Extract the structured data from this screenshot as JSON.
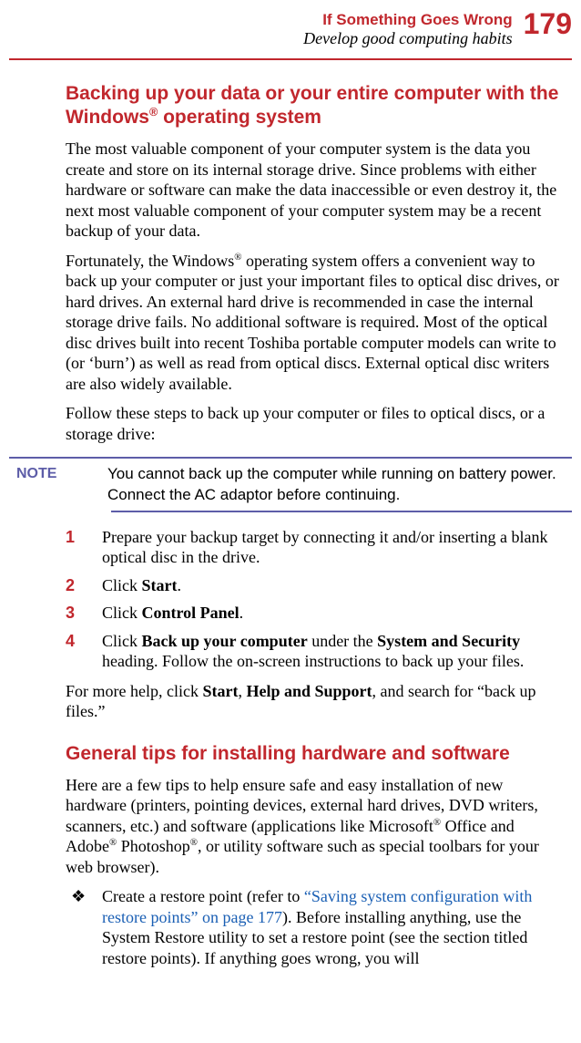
{
  "header": {
    "chapter": "If Something Goes Wrong",
    "section": "Develop good computing habits",
    "page": "179"
  },
  "h1_line1": "Backing up your data or your entire computer with the",
  "h1_line2_pre": "Windows",
  "h1_line2_post": " operating system",
  "p1": "The most valuable component of your computer system is the data you create and store on its internal storage drive. Since problems with either hardware or software can make the data inaccessible or even destroy it, the next most valuable component of your computer system may be a recent backup of your data.",
  "p2_a": "Fortunately, the Windows",
  "p2_b": " operating system offers a convenient way to back up your computer or just your important files to optical disc drives, or hard drives. An external hard drive is recommended in case the internal storage drive fails. No additional software is required. Most of the optical disc drives built into recent Toshiba portable computer models can write to (or ‘burn’) as well as read from optical discs. External optical disc writers are also widely available.",
  "p3": "Follow these steps to back up your computer or files to optical discs, or a storage drive:",
  "note": {
    "label": "NOTE",
    "text": "You cannot back up the computer while running on battery power. Connect the AC adaptor before continuing."
  },
  "steps": {
    "s1": "Prepare your backup target by connecting it and/or inserting a blank optical disc in the drive.",
    "s2_a": "Click ",
    "s2_b": "Start",
    "s2_c": ".",
    "s3_a": "Click ",
    "s3_b": "Control Panel",
    "s3_c": ".",
    "s4_a": "Click ",
    "s4_b": "Back up your computer",
    "s4_c": " under the ",
    "s4_d": "System and Security",
    "s4_e": " heading. Follow the on-screen instructions to back up your files."
  },
  "p4_a": "For more help, click ",
  "p4_b": "Start",
  "p4_c": ", ",
  "p4_d": "Help and Support",
  "p4_e": ", and search for “back up files.”",
  "h2": "General tips for installing hardware and software",
  "p5_a": "Here are a few tips to help ensure safe and easy installation of new hardware (printers, pointing devices, external hard drives, DVD writers, scanners, etc.) and software (applications like Microsoft",
  "p5_b": " Office and Adobe",
  "p5_c": " Photoshop",
  "p5_d": ", or utility software such as special toolbars for your web browser).",
  "bullet": {
    "b1_a": "Create a restore point (refer to ",
    "b1_link": "“Saving system configuration with restore points” on page 177",
    "b1_b": "). Before installing anything, use the System Restore utility to set a restore point (see the section titled restore points). If anything goes wrong, you will"
  }
}
